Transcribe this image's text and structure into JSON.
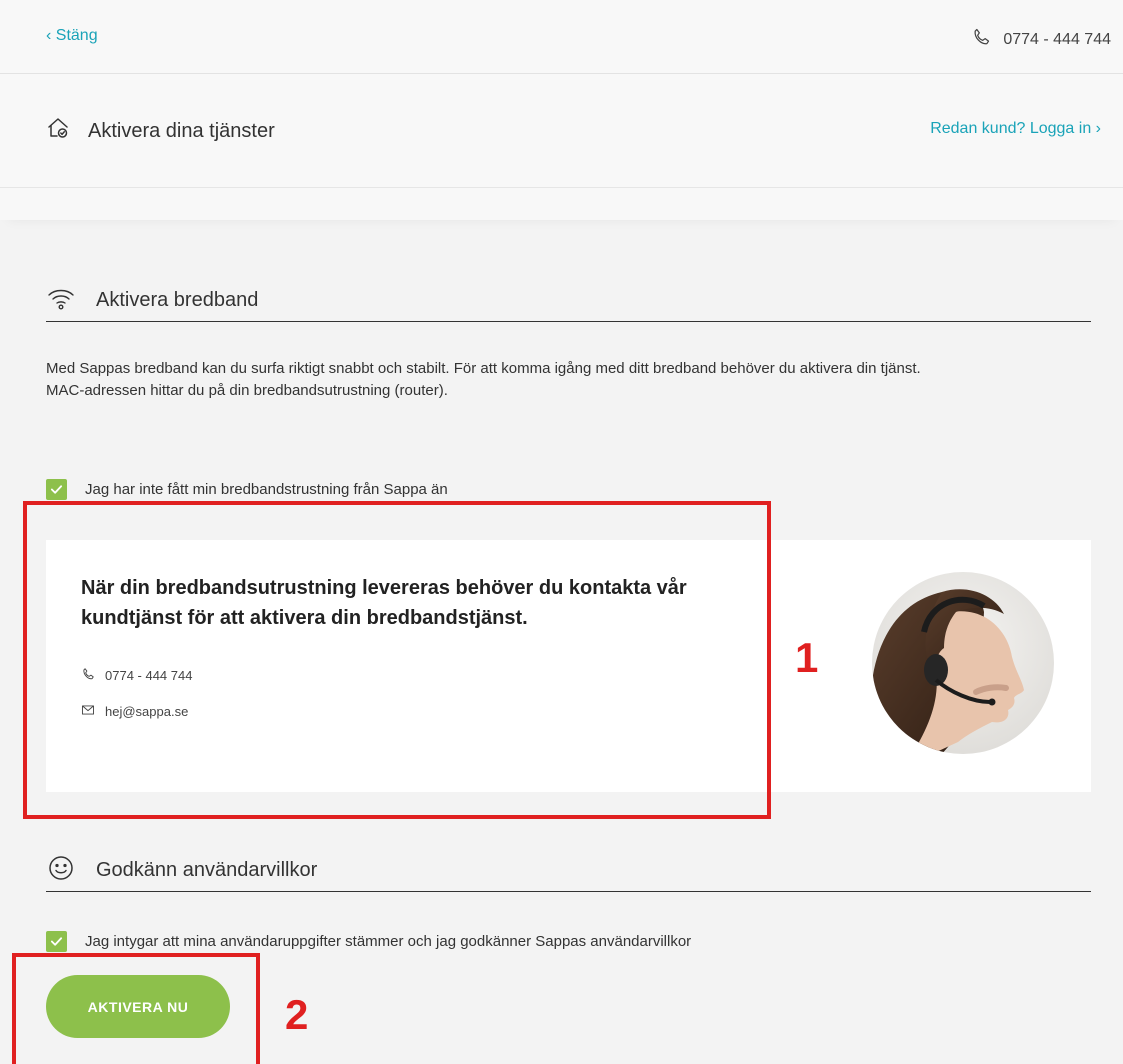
{
  "topbar": {
    "close_label": "‹ Stäng",
    "phone": "0774 - 444 744"
  },
  "header": {
    "title": "Aktivera dina tjänster",
    "login_link": "Redan kund? Logga in ›"
  },
  "broadband": {
    "section_title": "Aktivera bredband",
    "description_line1": "Med Sappas bredband kan du surfa riktigt snabbt och stabilt. För att komma igång med ditt bredband behöver du aktivera din tjänst.",
    "description_line2": "MAC-adressen hittar du på din bredbandsutrustning (router).",
    "checkbox_label": "Jag har inte fått min bredbandstrustning från Sappa än",
    "checkbox_checked": true
  },
  "info_card": {
    "title": "När din bredbandsutrustning levereras behöver du kontakta vår kundtjänst för att aktivera din bredbandstjänst.",
    "phone": "0774 - 444 744",
    "email": "hej@sappa.se"
  },
  "terms": {
    "section_title": "Godkänn användarvillkor",
    "checkbox_label": "Jag intygar att mina användaruppgifter stämmer och jag godkänner Sappas användarvillkor",
    "checkbox_checked": true
  },
  "actions": {
    "activate_label": "AKTIVERA NU"
  },
  "annotations": {
    "label_1": "1",
    "label_2": "2"
  },
  "colors": {
    "accent_link": "#1aa3b8",
    "accent_green": "#8dc04b",
    "annotation_red": "#e02020"
  }
}
